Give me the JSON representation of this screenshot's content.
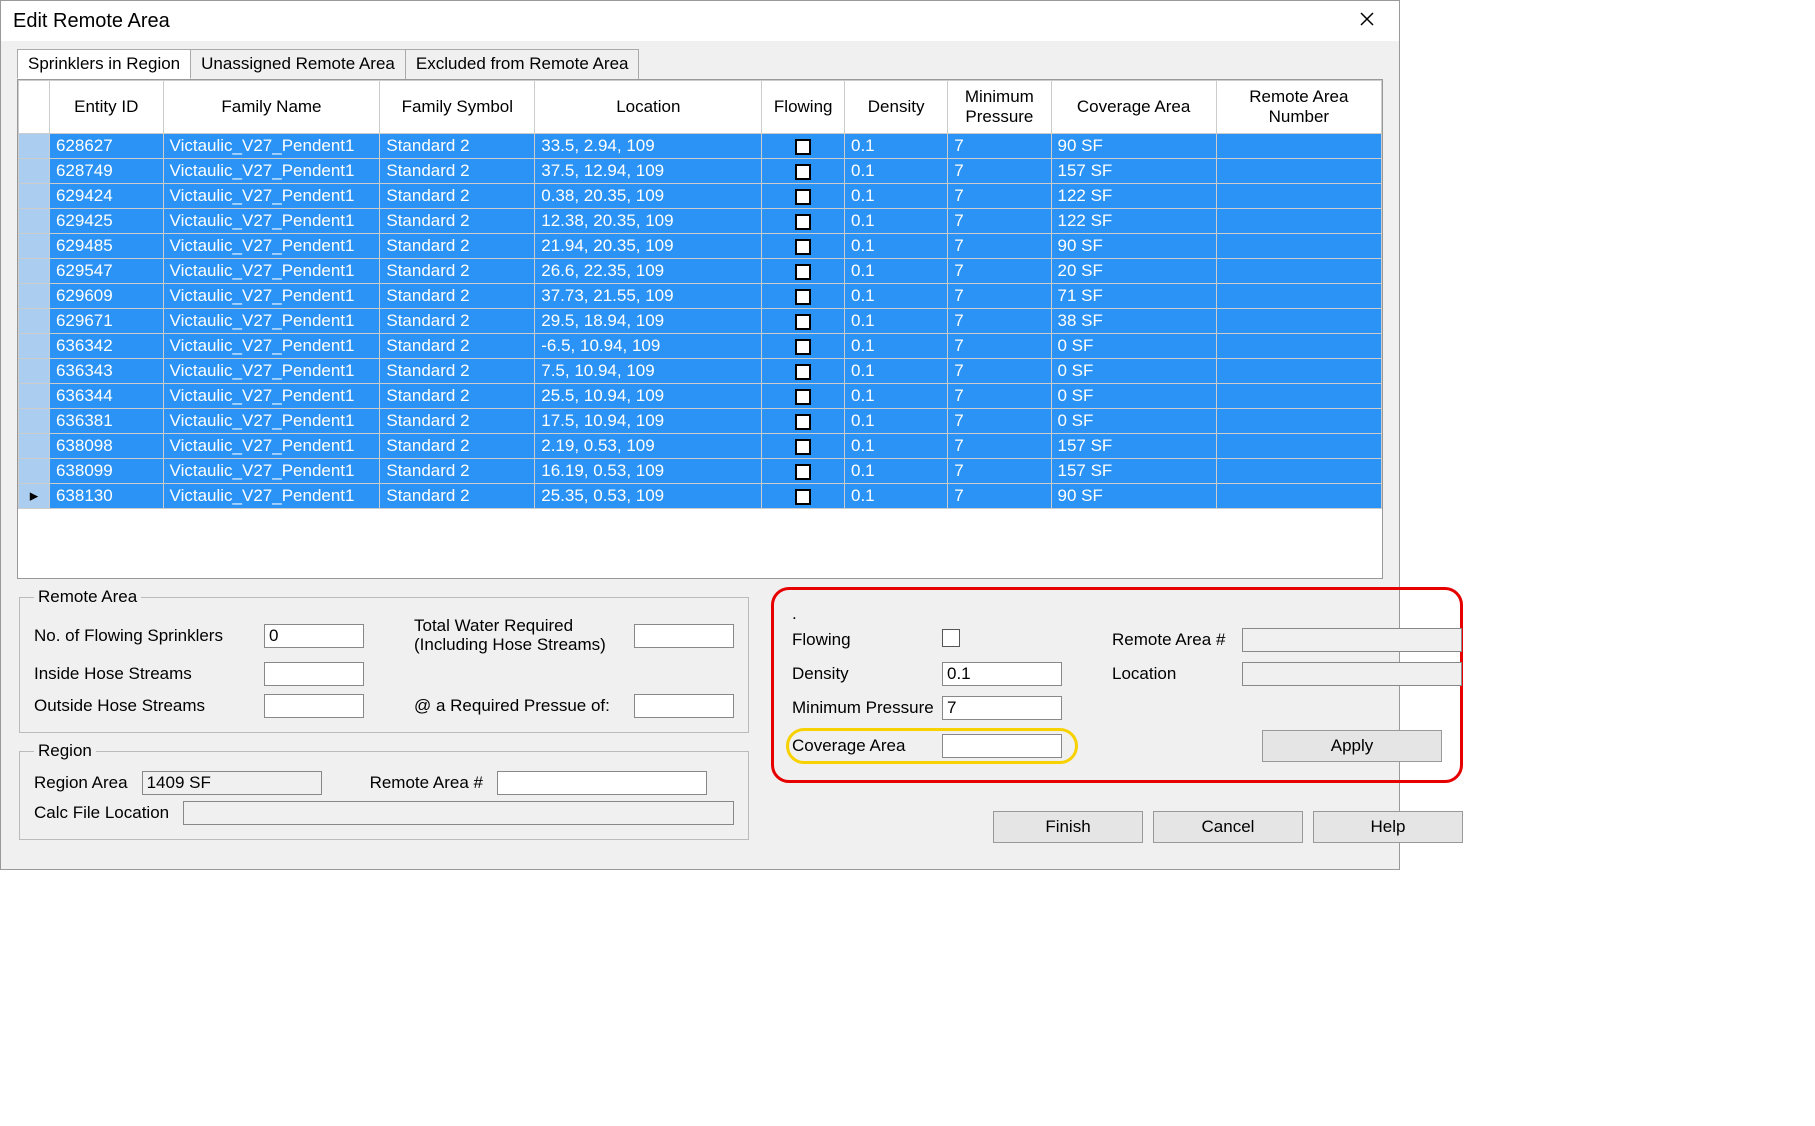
{
  "window": {
    "title": "Edit Remote Area"
  },
  "tabs": [
    {
      "label": "Sprinklers in Region",
      "active": true
    },
    {
      "label": "Unassigned Remote Area",
      "active": false
    },
    {
      "label": "Excluded from Remote Area",
      "active": false
    }
  ],
  "columns": [
    "",
    "Entity ID",
    "Family Name",
    "Family Symbol",
    "Location",
    "Flowing",
    "Density",
    "Minimum Pressure",
    "Coverage Area",
    "Remote Area Number"
  ],
  "rows": [
    {
      "marker": "",
      "entity": "628627",
      "family": "Victaulic_V27_Pendent1",
      "symbol": "Standard 2",
      "location": "33.5, 2.94, 109",
      "density": "0.1",
      "minp": "7",
      "cov": "90 SF",
      "ran": ""
    },
    {
      "marker": "",
      "entity": "628749",
      "family": "Victaulic_V27_Pendent1",
      "symbol": "Standard 2",
      "location": "37.5, 12.94, 109",
      "density": "0.1",
      "minp": "7",
      "cov": "157 SF",
      "ran": ""
    },
    {
      "marker": "",
      "entity": "629424",
      "family": "Victaulic_V27_Pendent1",
      "symbol": "Standard 2",
      "location": "0.38, 20.35, 109",
      "density": "0.1",
      "minp": "7",
      "cov": "122 SF",
      "ran": ""
    },
    {
      "marker": "",
      "entity": "629425",
      "family": "Victaulic_V27_Pendent1",
      "symbol": "Standard 2",
      "location": "12.38, 20.35, 109",
      "density": "0.1",
      "minp": "7",
      "cov": "122 SF",
      "ran": ""
    },
    {
      "marker": "",
      "entity": "629485",
      "family": "Victaulic_V27_Pendent1",
      "symbol": "Standard 2",
      "location": "21.94, 20.35, 109",
      "density": "0.1",
      "minp": "7",
      "cov": "90 SF",
      "ran": ""
    },
    {
      "marker": "",
      "entity": "629547",
      "family": "Victaulic_V27_Pendent1",
      "symbol": "Standard 2",
      "location": "26.6, 22.35, 109",
      "density": "0.1",
      "minp": "7",
      "cov": "20 SF",
      "ran": ""
    },
    {
      "marker": "",
      "entity": "629609",
      "family": "Victaulic_V27_Pendent1",
      "symbol": "Standard 2",
      "location": "37.73, 21.55, 109",
      "density": "0.1",
      "minp": "7",
      "cov": "71 SF",
      "ran": ""
    },
    {
      "marker": "",
      "entity": "629671",
      "family": "Victaulic_V27_Pendent1",
      "symbol": "Standard 2",
      "location": "29.5, 18.94, 109",
      "density": "0.1",
      "minp": "7",
      "cov": "38 SF",
      "ran": ""
    },
    {
      "marker": "",
      "entity": "636342",
      "family": "Victaulic_V27_Pendent1",
      "symbol": "Standard 2",
      "location": "-6.5, 10.94, 109",
      "density": "0.1",
      "minp": "7",
      "cov": "0 SF",
      "ran": ""
    },
    {
      "marker": "",
      "entity": "636343",
      "family": "Victaulic_V27_Pendent1",
      "symbol": "Standard 2",
      "location": "7.5, 10.94, 109",
      "density": "0.1",
      "minp": "7",
      "cov": "0 SF",
      "ran": ""
    },
    {
      "marker": "",
      "entity": "636344",
      "family": "Victaulic_V27_Pendent1",
      "symbol": "Standard 2",
      "location": "25.5, 10.94, 109",
      "density": "0.1",
      "minp": "7",
      "cov": "0 SF",
      "ran": ""
    },
    {
      "marker": "",
      "entity": "636381",
      "family": "Victaulic_V27_Pendent1",
      "symbol": "Standard 2",
      "location": "17.5, 10.94, 109",
      "density": "0.1",
      "minp": "7",
      "cov": "0 SF",
      "ran": ""
    },
    {
      "marker": "",
      "entity": "638098",
      "family": "Victaulic_V27_Pendent1",
      "symbol": "Standard 2",
      "location": "2.19, 0.53, 109",
      "density": "0.1",
      "minp": "7",
      "cov": "157 SF",
      "ran": ""
    },
    {
      "marker": "",
      "entity": "638099",
      "family": "Victaulic_V27_Pendent1",
      "symbol": "Standard 2",
      "location": "16.19, 0.53, 109",
      "density": "0.1",
      "minp": "7",
      "cov": "157 SF",
      "ran": ""
    },
    {
      "marker": "▸",
      "entity": "638130",
      "family": "Victaulic_V27_Pendent1",
      "symbol": "Standard 2",
      "location": "25.35, 0.53, 109",
      "density": "0.1",
      "minp": "7",
      "cov": "90 SF",
      "ran": ""
    }
  ],
  "remoteArea": {
    "legend": "Remote Area",
    "noFlowingLabel": "No. of Flowing Sprinklers",
    "noFlowingValue": "0",
    "insideHoseLabel": "Inside Hose Streams",
    "insideHoseValue": "",
    "outsideHoseLabel": "Outside Hose Streams",
    "outsideHoseValue": "",
    "totalWaterLabel": "Total Water Required (Including Hose Streams)",
    "totalWaterValue": "",
    "atReqPressureLabel": "@ a Required Pressue of:",
    "atReqPressureValue": ""
  },
  "region": {
    "legend": "Region",
    "regionAreaLabel": "Region Area",
    "regionAreaValue": "1409 SF",
    "remoteAreaNumLabel": "Remote Area #",
    "remoteAreaNumValue": "",
    "calcFileLabel": "Calc File Location",
    "calcFileValue": ""
  },
  "editPanel": {
    "dotLabel": ".",
    "flowingLabel": "Flowing",
    "remoteAreaNumLabel": "Remote Area #",
    "remoteAreaNumValue": "",
    "densityLabel": "Density",
    "densityValue": "0.1",
    "locationLabel": "Location",
    "locationValue": "",
    "minPressureLabel": "Minimum Pressure",
    "minPressureValue": "7",
    "coverageLabel": "Coverage Area",
    "coverageValue": "",
    "applyLabel": "Apply"
  },
  "buttons": {
    "finish": "Finish",
    "cancel": "Cancel",
    "help": "Help"
  }
}
